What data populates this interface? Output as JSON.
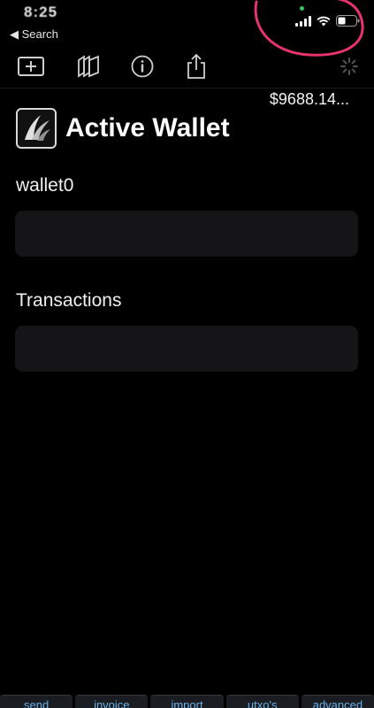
{
  "status_bar": {
    "time": "8:25",
    "back_label": "◀ Search"
  },
  "balance": "$9688.14...",
  "page_title": "Active Wallet",
  "wallet_section": {
    "label": "wallet0"
  },
  "transactions_section": {
    "label": "Transactions"
  },
  "toolbar": {
    "icons": [
      "add-icon",
      "wallets-stack-icon",
      "info-icon",
      "share-icon",
      "loading-spinner-icon"
    ]
  },
  "bottom_tabs": [
    "send",
    "invoice",
    "import",
    "utxo's",
    "advanced"
  ],
  "colors": {
    "background": "#000000",
    "panel": "#151517",
    "tab_text": "#6cb0e8",
    "annotation": "#e8336d",
    "privacy_dot": "#33c85a"
  }
}
